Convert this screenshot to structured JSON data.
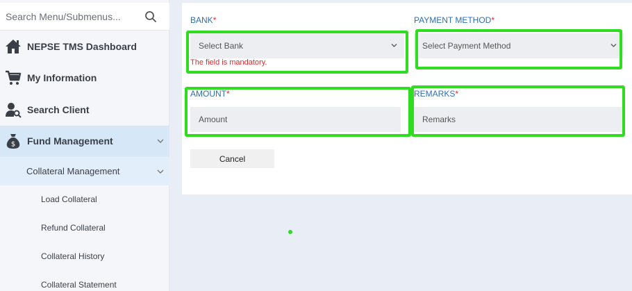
{
  "sidebar": {
    "search_placeholder": "Search Menu/Submenus...",
    "items": [
      {
        "label": "NEPSE TMS Dashboard",
        "icon": "home-icon"
      },
      {
        "label": "My Information",
        "icon": "cart-icon"
      },
      {
        "label": "Search Client",
        "icon": "user-search-icon"
      },
      {
        "label": "Fund Management",
        "icon": "money-bag-icon"
      }
    ],
    "submenu": {
      "label": "Collateral Management",
      "items": [
        {
          "label": "Load Collateral"
        },
        {
          "label": "Refund Collateral"
        },
        {
          "label": "Collateral History"
        },
        {
          "label": "Collateral Statement"
        }
      ]
    }
  },
  "form": {
    "bank": {
      "label": "BANK",
      "value": "Select Bank",
      "error": "The field is mandatory."
    },
    "payment_method": {
      "label": "PAYMENT METHOD",
      "value": "Select Payment Method"
    },
    "amount": {
      "label": "AMOUNT",
      "placeholder": "Amount"
    },
    "remarks": {
      "label": "REMARKS",
      "placeholder": "Remarks"
    },
    "required_mark": "*",
    "cancel_label": "Cancel"
  },
  "colors": {
    "accent_blue": "#2d6fb3",
    "error_red": "#d32f2f",
    "annotation_green": "#2fdc1f",
    "active_nav_bg": "#d6e8f8"
  }
}
